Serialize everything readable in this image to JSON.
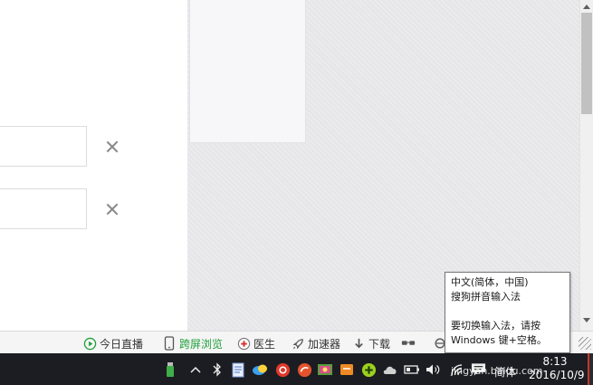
{
  "statusbar": {
    "items": [
      {
        "label": "今日直播",
        "icon": "play-circle-icon"
      },
      {
        "label": "跨屏浏览",
        "icon": "phone-icon",
        "highlight": true
      },
      {
        "label": "医生",
        "icon": "medical-cross-icon"
      },
      {
        "label": "加速器",
        "icon": "rocket-icon"
      },
      {
        "label": "下载",
        "icon": "download-arrow-icon"
      }
    ]
  },
  "tooltip": {
    "line1": "中文(简体，中国)",
    "line2": "搜狗拼音输入法",
    "line3": "要切换输入法，请按",
    "line4": "Windows 键+空格。"
  },
  "taskbar": {
    "ime_label": "简体",
    "time": "8:13",
    "date": "2016/10/9",
    "watermark": "jingyan.baidu.com"
  },
  "colors": {
    "accent_green": "#1e9e3a",
    "taskbar_bg": "#1c1d22",
    "page_bg": "#e6e5e8"
  }
}
